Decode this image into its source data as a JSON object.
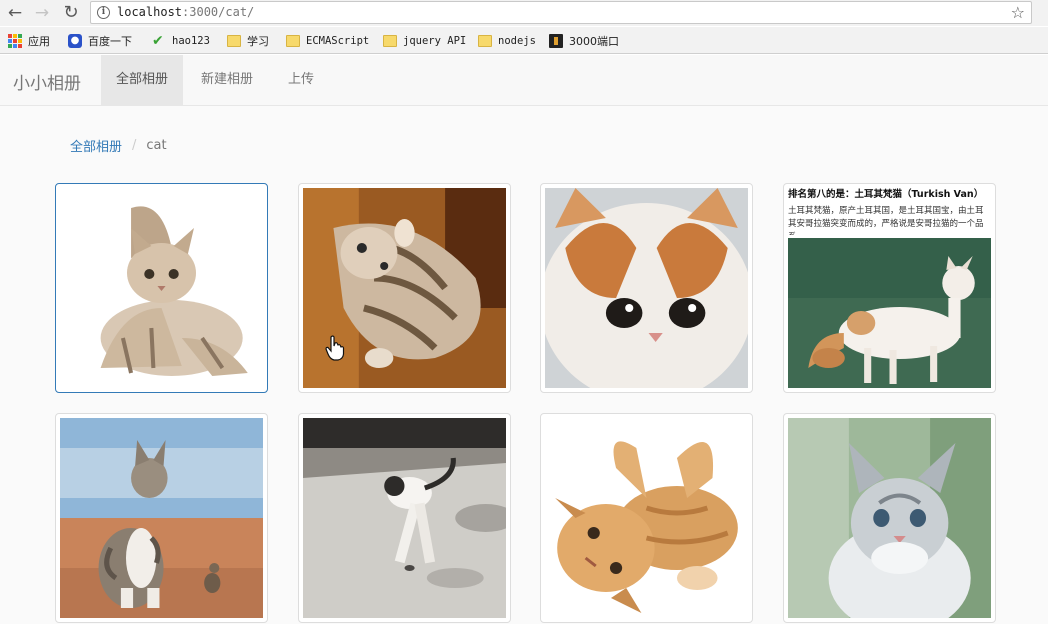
{
  "browser": {
    "url_host": "localhost",
    "url_path": ":3000/cat/",
    "bookmarks": [
      {
        "label": "应用",
        "icon": "apps-grid-icon"
      },
      {
        "label": "百度一下",
        "icon": "baidu-paw-icon"
      },
      {
        "label": "hao123",
        "icon": "hao123-icon"
      },
      {
        "label": "学习",
        "icon": "folder-icon"
      },
      {
        "label": "ECMAScript",
        "icon": "folder-icon"
      },
      {
        "label": "jquery API",
        "icon": "folder-icon"
      },
      {
        "label": "nodejs",
        "icon": "folder-icon"
      },
      {
        "label": "3000端口",
        "icon": "page-icon"
      }
    ]
  },
  "navbar": {
    "brand": "小小相册",
    "items": [
      {
        "label": "全部相册",
        "active": true
      },
      {
        "label": "新建相册",
        "active": false
      },
      {
        "label": "上传",
        "active": false
      }
    ]
  },
  "breadcrumb": {
    "link": "全部相册",
    "separator": "/",
    "current": "cat"
  },
  "photos": [
    {
      "subject": "kitten-crouching-white-background"
    },
    {
      "subject": "kitten-lying-on-wood-floor"
    },
    {
      "subject": "snub-nosed-exotic-kitten-closeup"
    },
    {
      "subject": "turkish-van-cat-info-card",
      "caption_title": "排名第八的是：土耳其梵猫（Turkish Van）",
      "caption_text": "土耳其梵猫，原产土耳其国，是土耳其国宝，由土耳其安哥拉猫突变而成的，严格说是安哥拉猫的一个品系。"
    },
    {
      "subject": "tabby-cat-on-red-sand"
    },
    {
      "subject": "white-cat-leaping-on-pavement"
    },
    {
      "subject": "orange-kitten-rolling-on-back"
    },
    {
      "subject": "grey-white-kitten-portrait"
    }
  ],
  "colors": {
    "link": "#337ab7",
    "navbar_bg": "#f8f8f8",
    "nav_active_bg": "#e7e7e7",
    "thumb_border_hover": "#337ab7"
  }
}
